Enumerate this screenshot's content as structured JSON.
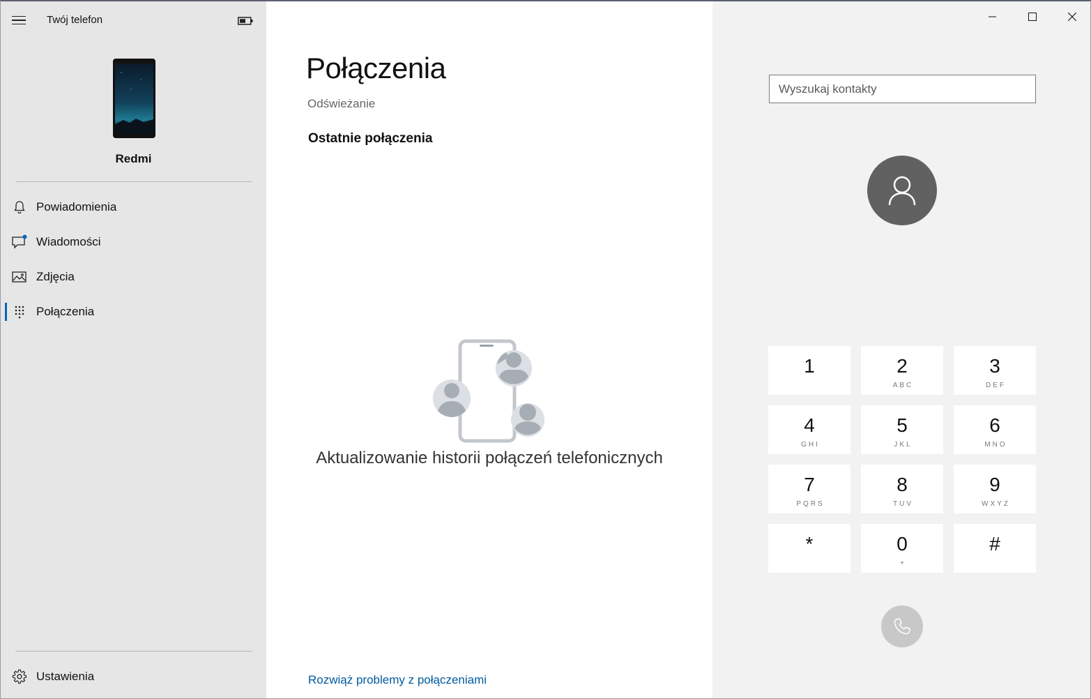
{
  "app": {
    "title": "Twój telefon"
  },
  "sidebar": {
    "device_name": "Redmi",
    "items": [
      {
        "id": "notifications",
        "label": "Powiadomienia",
        "icon": "bell-icon"
      },
      {
        "id": "messages",
        "label": "Wiadomości",
        "icon": "chat-icon",
        "badge": true
      },
      {
        "id": "photos",
        "label": "Zdjęcia",
        "icon": "photos-icon"
      },
      {
        "id": "calls",
        "label": "Połączenia",
        "icon": "dialpad-icon",
        "active": true
      }
    ],
    "settings_label": "Ustawienia"
  },
  "main": {
    "title": "Połączenia",
    "status": "Odświeżanie",
    "section_title": "Ostatnie połączenia",
    "empty_message": "Aktualizowanie historii połączeń telefonicznych",
    "troubleshoot_link": "Rozwiąż problemy z połączeniami"
  },
  "dialer": {
    "search_placeholder": "Wyszukaj kontakty",
    "keys": [
      {
        "digit": "1",
        "letters": ""
      },
      {
        "digit": "2",
        "letters": "ABC"
      },
      {
        "digit": "3",
        "letters": "DEF"
      },
      {
        "digit": "4",
        "letters": "GHI"
      },
      {
        "digit": "5",
        "letters": "JKL"
      },
      {
        "digit": "6",
        "letters": "MNO"
      },
      {
        "digit": "7",
        "letters": "PQRS"
      },
      {
        "digit": "8",
        "letters": "TUV"
      },
      {
        "digit": "9",
        "letters": "WXYZ"
      },
      {
        "digit": "*",
        "letters": ""
      },
      {
        "digit": "0",
        "letters": "+"
      },
      {
        "digit": "#",
        "letters": ""
      }
    ]
  },
  "colors": {
    "accent": "#0067c0",
    "link": "#005a9e",
    "sidebar_bg": "#e6e6e6",
    "avatar_bg": "#616161",
    "call_button_disabled": "#c8c8c8"
  }
}
